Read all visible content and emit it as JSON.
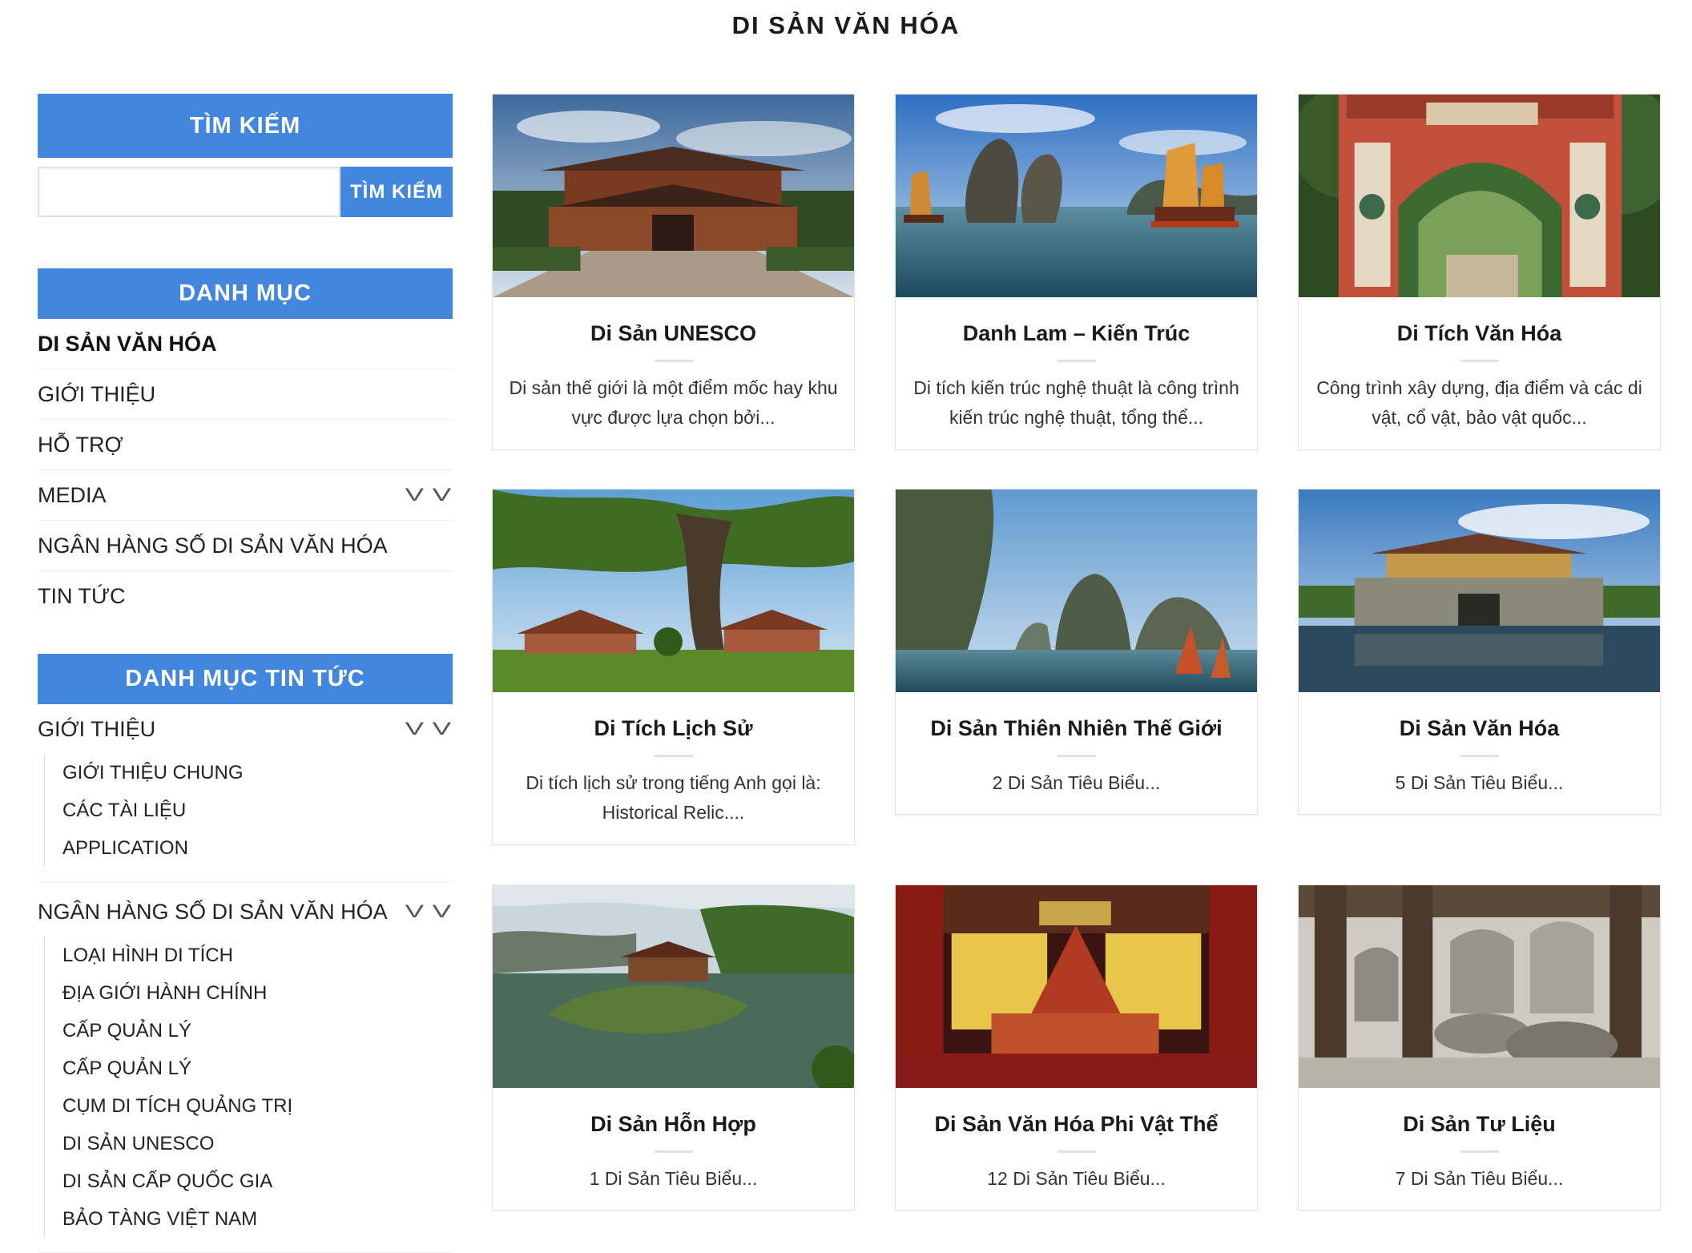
{
  "page": {
    "title": "DI SẢN VĂN HÓA"
  },
  "search": {
    "title": "TÌM KIẾM",
    "button": "TÌM KIẾM",
    "placeholder": ""
  },
  "categories": {
    "title": "DANH MỤC",
    "items": [
      {
        "label": "DI SẢN VĂN HÓA"
      },
      {
        "label": "GIỚI THIỆU"
      },
      {
        "label": "HỖ TRỢ"
      },
      {
        "label": "MEDIA"
      },
      {
        "label": "NGÂN HÀNG SỐ DI SẢN VĂN HÓA"
      },
      {
        "label": "TIN TỨC"
      }
    ]
  },
  "news_categories": {
    "title": "DANH MỤC TIN TỨC",
    "sections": [
      {
        "label": "GIỚI THIỆU",
        "children": [
          "GIỚI THIỆU CHUNG",
          "CÁC TÀI LIỆU",
          "APPLICATION"
        ]
      },
      {
        "label": "NGÂN HÀNG SỐ DI SẢN VĂN HÓA",
        "children": [
          "LOẠI HÌNH DI TÍCH",
          "ĐỊA GIỚI HÀNH CHÍNH",
          "CẤP QUẢN LÝ",
          "CẤP QUẢN LÝ",
          "CỤM DI TÍCH QUẢNG TRỊ",
          "DI SẢN UNESCO",
          "DI SẢN CẤP QUỐC GIA",
          "BẢO TÀNG VIỆT NAM"
        ]
      }
    ]
  },
  "cards": [
    {
      "title": "Di Sản UNESCO",
      "desc1": "Di sản thế giới là một điểm mốc hay khu",
      "desc2": "vực được lựa chọn bởi...",
      "image": "imperial-palace-photo"
    },
    {
      "title": "Danh Lam – Kiến Trúc",
      "desc1": "Di tích kiến trúc nghệ thuật là công trình",
      "desc2": "kiến trúc nghệ thuật, tổng thể...",
      "image": "halong-bay-junks-photo"
    },
    {
      "title": "Di Tích Văn Hóa",
      "desc1": "Công trình xây dựng, địa điểm và các di",
      "desc2": "vật, cổ vật, bảo vật quốc...",
      "image": "red-temple-gate-photo"
    },
    {
      "title": "Di Tích Lịch Sử",
      "desc1": "Di tích lịch sử trong tiếng Anh gọi là:",
      "desc2": "Historical Relic....",
      "image": "banyan-tree-temple-photo"
    },
    {
      "title": "Di Sản Thiên Nhiên Thế Giới",
      "desc1": "2 Di Sản Tiêu Biểu...",
      "desc2": "",
      "image": "limestone-karst-sails-photo"
    },
    {
      "title": "Di Sản Văn Hóa",
      "desc1": "5 Di Sản Tiêu Biểu...",
      "desc2": "",
      "image": "citadel-gate-reflection-photo"
    },
    {
      "title": "Di Sản Hỗn Hợp",
      "desc1": "1 Di Sản Tiêu Biểu...",
      "desc2": "",
      "image": "trang-an-aerial-photo"
    },
    {
      "title": "Di Sản Văn Hóa Phi Vật Thể",
      "desc1": "12 Di Sản Tiêu Biểu...",
      "desc2": "",
      "image": "water-puppet-stage-photo"
    },
    {
      "title": "Di Sản Tư Liệu",
      "desc1": "7 Di Sản Tiêu Biểu...",
      "desc2": "",
      "image": "stone-stelae-turtles-photo"
    }
  ],
  "colors": {
    "accent": "#4286dd"
  }
}
